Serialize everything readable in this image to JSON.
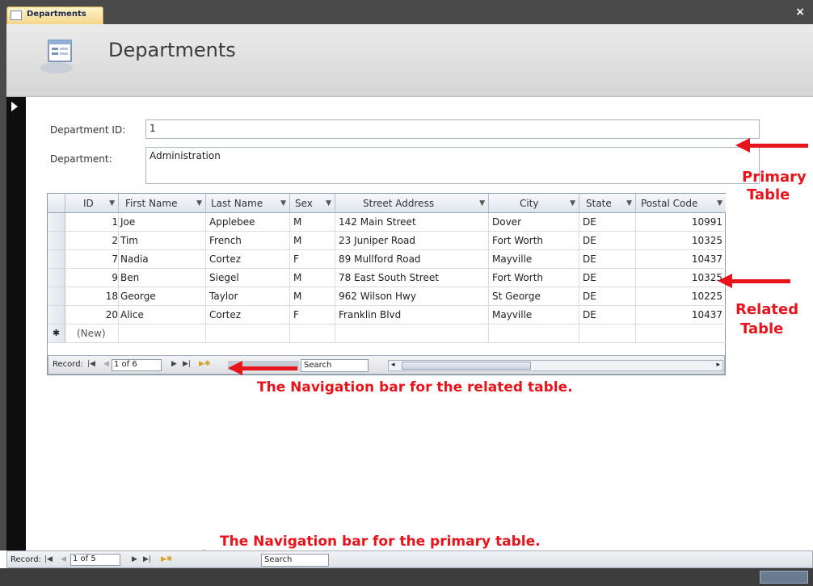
{
  "tab": {
    "label": "Departments",
    "close": "×"
  },
  "header": {
    "title": "Departments"
  },
  "form": {
    "dept_id_label": "Department ID:",
    "dept_id_value": "1",
    "dept_label": "Department:",
    "dept_value": "Administration"
  },
  "subgrid": {
    "columns": [
      "ID",
      "First Name",
      "Last Name",
      "Sex",
      "Street Address",
      "City",
      "State",
      "Postal Code"
    ],
    "rows": [
      [
        "1",
        "Joe",
        "Applebee",
        "M",
        "142 Main Street",
        "Dover",
        "DE",
        "10991"
      ],
      [
        "2",
        "Tim",
        "French",
        "M",
        "23 Juniper Road",
        "Fort Worth",
        "DE",
        "10325"
      ],
      [
        "7",
        "Nadia",
        "Cortez",
        "F",
        "89 Mullford Road",
        "Mayville",
        "DE",
        "10437"
      ],
      [
        "9",
        "Ben",
        "Siegel",
        "M",
        "78 East South Street",
        "Fort Worth",
        "DE",
        "10325"
      ],
      [
        "18",
        "George",
        "Taylor",
        "M",
        "962 Wilson Hwy",
        "St George",
        "DE",
        "10225"
      ],
      [
        "20",
        "Alice",
        "Cortez",
        "F",
        "Franklin Blvd",
        "Mayville",
        "DE",
        "10437"
      ]
    ],
    "new_row": "(New)",
    "new_marker": "✱"
  },
  "sub_nav": {
    "record_label": "Record:",
    "position": "1 of 6",
    "search": "Search"
  },
  "main_nav": {
    "record_label": "Record:",
    "position": "1 of 5",
    "search": "Search"
  },
  "annotations": {
    "primary_line1": "Primary",
    "primary_line2": "Table",
    "related_line1": "Related",
    "related_line2": "Table",
    "related_nav": "The Navigation bar for the related table.",
    "primary_nav": "The Navigation bar for the primary table."
  },
  "colors": {
    "annotation": "#e8141b",
    "tab_active": "#f6d58a"
  }
}
